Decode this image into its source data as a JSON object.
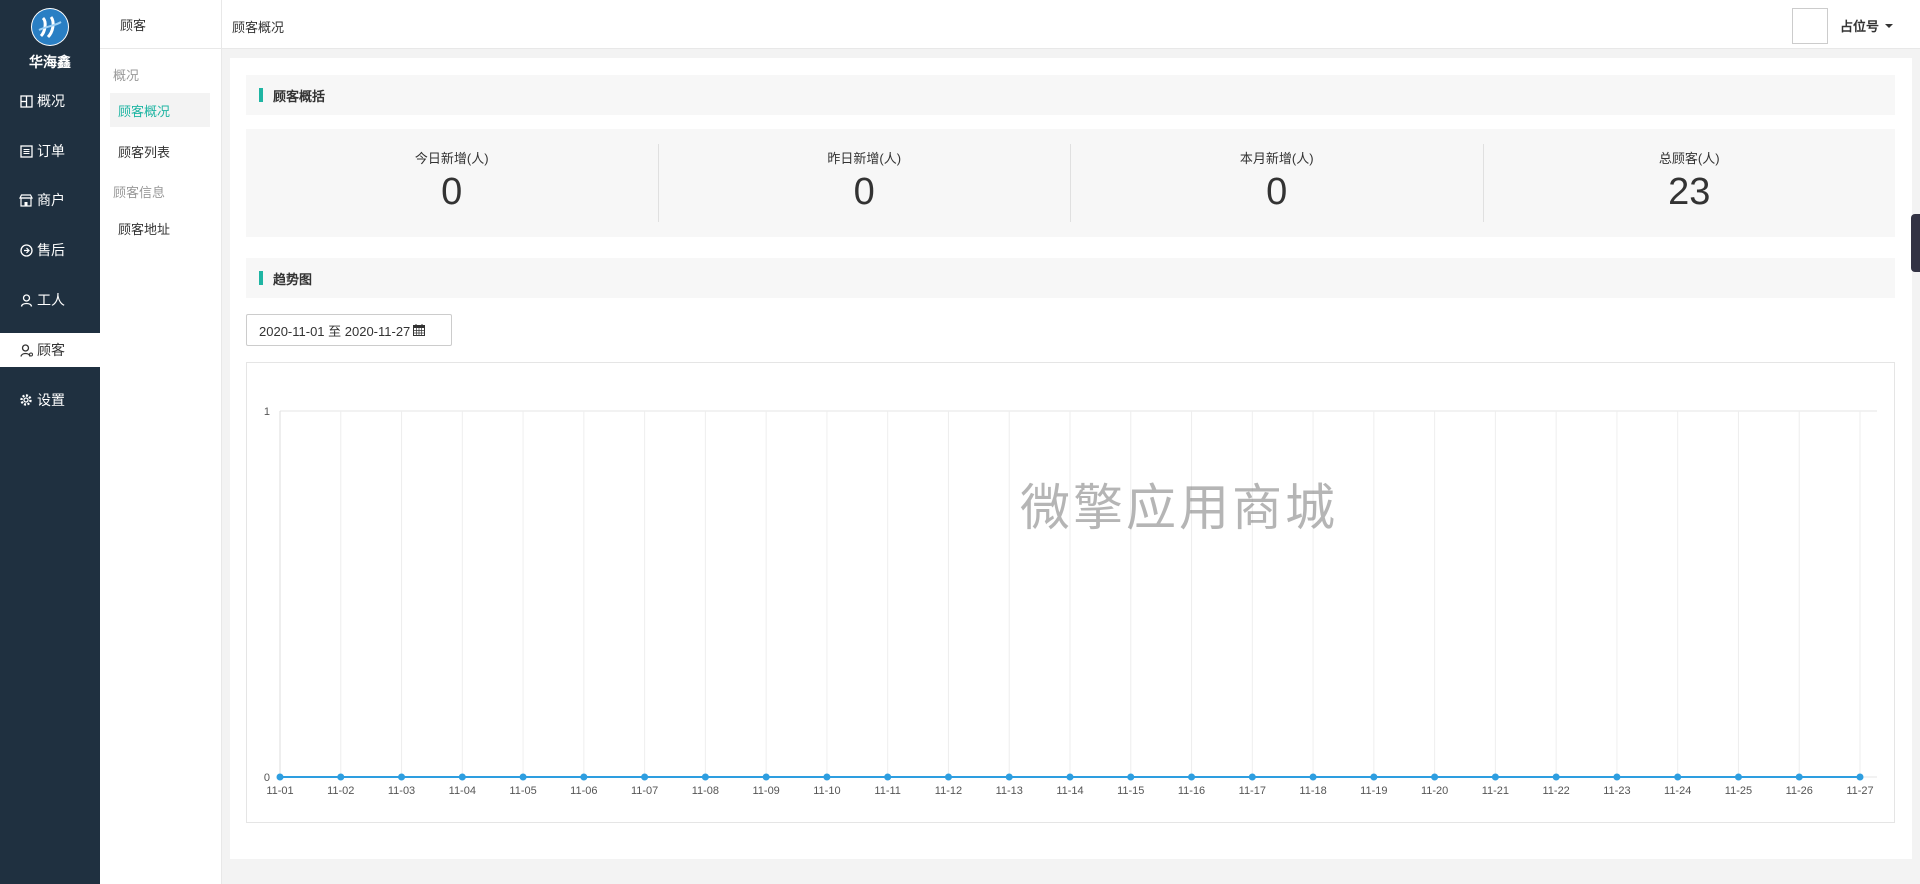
{
  "brand": {
    "name": "华海鑫"
  },
  "nav": {
    "items": [
      {
        "label": "概况",
        "icon": "dashboard-icon"
      },
      {
        "label": "订单",
        "icon": "list-icon"
      },
      {
        "label": "商户",
        "icon": "shop-icon"
      },
      {
        "label": "售后",
        "icon": "service-icon"
      },
      {
        "label": "工人",
        "icon": "worker-icon"
      },
      {
        "label": "顾客",
        "icon": "customer-icon",
        "active": true
      },
      {
        "label": "设置",
        "icon": "gear-icon"
      }
    ]
  },
  "subnav": {
    "title": "顾客",
    "group1": "概况",
    "link_overview": "顾客概况",
    "link_list": "顾客列表",
    "group2": "顾客信息",
    "link_address": "顾客地址"
  },
  "topbar": {
    "breadcrumb": "顾客概况",
    "user": "占位号"
  },
  "summary": {
    "title": "顾客概括",
    "stats": [
      {
        "label": "今日新增(人)",
        "value": "0"
      },
      {
        "label": "昨日新增(人)",
        "value": "0"
      },
      {
        "label": "本月新增(人)",
        "value": "0"
      },
      {
        "label": "总顾客(人)",
        "value": "23"
      }
    ]
  },
  "trend": {
    "title": "趋势图",
    "date_range": "2020-11-01 至 2020-11-27"
  },
  "watermark": "微擎应用商城",
  "colors": {
    "accent": "#1fb5a3",
    "line": "#2e9ee0",
    "nav_bg": "#1f3040"
  },
  "chart_data": {
    "type": "line",
    "categories": [
      "11-01",
      "11-02",
      "11-03",
      "11-04",
      "11-05",
      "11-06",
      "11-07",
      "11-08",
      "11-09",
      "11-10",
      "11-11",
      "11-12",
      "11-13",
      "11-14",
      "11-15",
      "11-16",
      "11-17",
      "11-18",
      "11-19",
      "11-20",
      "11-21",
      "11-22",
      "11-23",
      "11-24",
      "11-25",
      "11-26",
      "11-27"
    ],
    "values": [
      0,
      0,
      0,
      0,
      0,
      0,
      0,
      0,
      0,
      0,
      0,
      0,
      0,
      0,
      0,
      0,
      0,
      0,
      0,
      0,
      0,
      0,
      0,
      0,
      0,
      0,
      0
    ],
    "ylim": [
      0,
      1
    ],
    "yticks": [
      0,
      1
    ],
    "grid": true
  }
}
